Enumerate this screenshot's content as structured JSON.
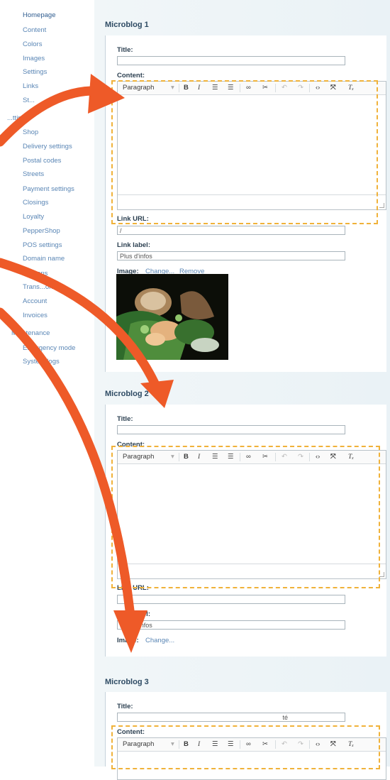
{
  "sidebar": {
    "items": [
      {
        "label": "Homepage",
        "active": true
      },
      {
        "label": "Content"
      },
      {
        "label": "Colors"
      },
      {
        "label": "Images"
      },
      {
        "label": "Settings"
      },
      {
        "label": "Links"
      },
      {
        "label": "St..."
      },
      {
        "label": "...ttings",
        "section": true
      },
      {
        "label": "Shop"
      },
      {
        "label": "Delivery settings"
      },
      {
        "label": "Postal codes"
      },
      {
        "label": "Streets"
      },
      {
        "label": "Payment settings"
      },
      {
        "label": "Closings"
      },
      {
        "label": "Loyalty"
      },
      {
        "label": "PepperShop"
      },
      {
        "label": "POS settings"
      },
      {
        "label": "Domain name"
      },
      {
        "label": "Add-ons"
      },
      {
        "label": "Trans...ons"
      },
      {
        "label": "Account"
      },
      {
        "label": "Invoices"
      },
      {
        "label": "Maintenance",
        "section": true
      },
      {
        "label": "Emergency mode"
      },
      {
        "label": "System logs"
      }
    ]
  },
  "microblogs": [
    {
      "heading": "Microblog 1",
      "title_label": "Title:",
      "title_value": "",
      "content_label": "Content:",
      "link_url_label": "Link URL:",
      "link_url_value": "/",
      "link_label_label": "Link label:",
      "link_label_value": "Plus d'infos",
      "image_label": "Image:",
      "image_change": "Change...",
      "image_remove": "Remove"
    },
    {
      "heading": "Microblog 2",
      "title_label": "Title:",
      "title_value": "",
      "content_label": "Content:",
      "link_url_label": "Link URL:",
      "link_url_value": "",
      "link_label_label": "Link label:",
      "link_label_value": "Plus d'infos",
      "image_label": "Image:",
      "image_change": "Change..."
    },
    {
      "heading": "Microblog 3",
      "title_label": "Title:",
      "title_value": "té",
      "content_label": "Content:"
    }
  ],
  "toolbar": {
    "format_label": "Paragraph",
    "dropdown_icon": "chevron-down-icon",
    "buttons": [
      "bold-icon",
      "italic-icon",
      "numbered-list-icon",
      "bullet-list-icon",
      "link-icon",
      "unlink-icon",
      "undo-icon",
      "redo-icon",
      "source-code-icon",
      "fullscreen-icon",
      "clear-format-icon"
    ]
  },
  "colors": {
    "arrow": "#ee5a28",
    "dash": "#f0b23a",
    "link": "#5a86b5"
  }
}
